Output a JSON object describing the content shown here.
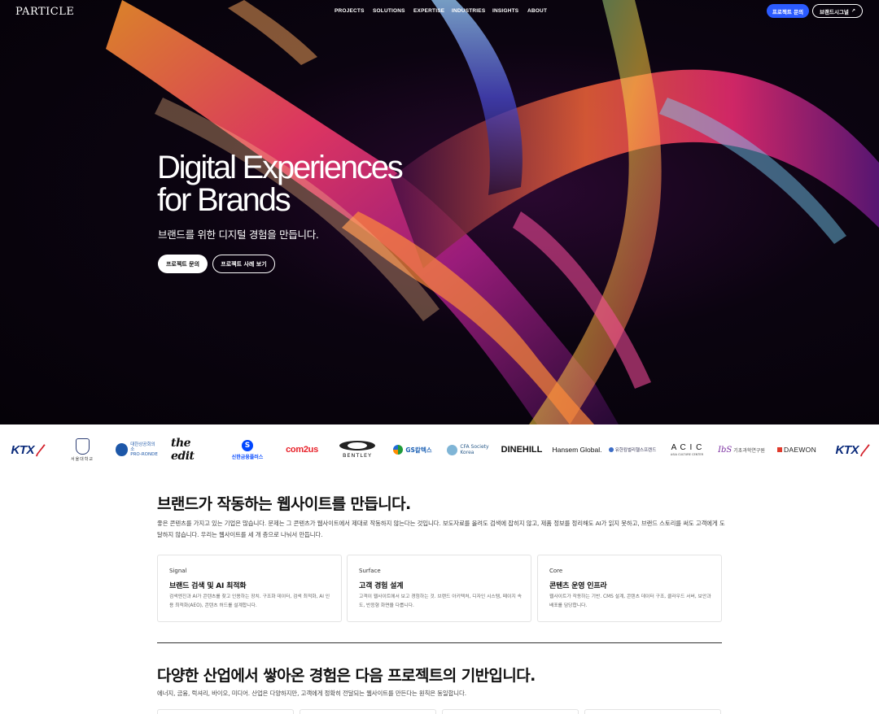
{
  "nav": {
    "logo": "PARTICLE",
    "menu": [
      "PROJECTS",
      "SOLUTIONS",
      "EXPERTISE",
      "INDUSTRIES",
      "INSIGHTS",
      "ABOUT"
    ],
    "inquiry_button": "프로젝트 문의",
    "brand_button": "브랜드시그널",
    "brand_button_icon": "external-link-icon"
  },
  "hero": {
    "title_line1": "Digital Experiences",
    "title_line2": "for Brands",
    "subtitle": "브랜드를 위한 디지털 경험을 만듭니다.",
    "primary_button": "프로젝트 문의",
    "secondary_button": "프로젝트 사례 보기"
  },
  "clients": {
    "ktx": "KTX",
    "snu": "서울대학교",
    "ronde": [
      "대한상공회의소",
      "PRO-RONDE"
    ],
    "the_edit": "the edit",
    "shinhan": "신한금융플러스",
    "com2us": "com2us",
    "bentley": "BENTLEY",
    "gs": "GS칼텍스",
    "cfa": [
      "CFA Society",
      "Korea"
    ],
    "dinehill": "DINEHILL",
    "hansem": "Hansem Global.",
    "yuhan": "유한킴벌리헬스프렌드",
    "acic": "A C I C",
    "acic_sub": "ASIA CULTURE CENTER",
    "ibs": "기초과학연구원",
    "daewon": "DAEWON"
  },
  "section1": {
    "title": "브랜드가 작동하는 웹사이트를 만듭니다.",
    "description": "좋은 콘텐츠를 가지고 있는 기업은 많습니다. 문제는 그 콘텐츠가 웹사이트에서 제대로 작동하지 않는다는 것입니다. 보도자료를 올려도 검색에 잡히지 않고, 제품 정보를 정리해도 AI가 읽지 못하고, 브랜드 스토리를 써도 고객에게 도달하지 않습니다. 우리는 웹사이트를 세 개 층으로 나눠서 만듭니다.",
    "cards": [
      {
        "keyword": "Signal",
        "title": "브랜드 검색 및 AI 최적화",
        "body": "검색엔진과 AI가 콘텐츠를 찾고 인용하는 장치. 구조화 데이터, 검색 최적화, AI 인용 최적화(AEO), 콘텐츠 허드를 설계합니다."
      },
      {
        "keyword": "Surface",
        "title": "고객 경험 설계",
        "body": "고객이 웹사이트에서 보고 경험하는 것. 브랜드 아키텍처, 디자인 시스템, 페이지 속도, 반응형 화면을 다룹니다."
      },
      {
        "keyword": "Core",
        "title": "콘텐츠 운영 인프라",
        "body": "웹사이트가 작동하는 기반. CMS 설계, 콘텐츠 데이터 구조, 클라우드 서버, 보안과 배포를 담당합니다."
      }
    ]
  },
  "section2": {
    "title": "다양한 산업에서 쌓아온 경험은 다음 프로젝트의 기반입니다.",
    "description": "에너지, 금융, 럭셔리, 바이오, 미디어. 산업은 다양하지만, 고객에게 정확히 전달되는 웹사이트를 만든다는 원칙은 동일합니다."
  }
}
